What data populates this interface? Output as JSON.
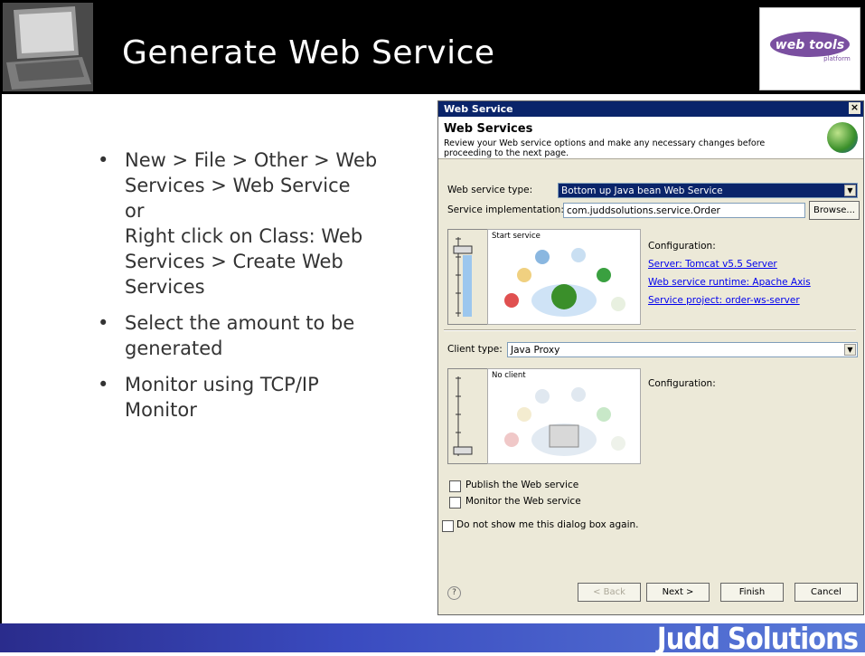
{
  "slide": {
    "title": "Generate Web Service",
    "logo_text": "web tools",
    "logo_sub": "platform",
    "footer_brand": "Judd Solutions"
  },
  "bullets": [
    {
      "lines": [
        "New > File > Other > Web",
        "Services > Web Service",
        "or",
        "Right click on Class:  Web",
        "Services > Create Web",
        "Services"
      ]
    },
    {
      "lines": [
        "Select the amount to be",
        "generated"
      ]
    },
    {
      "lines": [
        "Monitor using TCP/IP",
        "Monitor"
      ]
    }
  ],
  "dialog": {
    "title": "Web Service",
    "close_glyph": "×",
    "header_title": "Web Services",
    "header_desc": "Review your Web service options and make any necessary changes before proceeding to the next page.",
    "service_type_label": "Web service type:",
    "service_type_value": "Bottom up Java bean Web Service",
    "impl_label": "Service implementation:",
    "impl_value": "com.juddsolutions.service.Order",
    "browse_label": "Browse...",
    "server_slider_label": "Start service",
    "server_config_label": "Configuration:",
    "server_links": [
      "Server: Tomcat v5.5 Server",
      "Web service runtime: Apache Axis",
      "Service project: order-ws-server"
    ],
    "client_type_label": "Client type:",
    "client_type_value": "Java Proxy",
    "client_slider_label": "No client",
    "client_config_label": "Configuration:",
    "publish_label": "Publish the Web service",
    "monitor_label": "Monitor the Web service",
    "dont_show_label": "Do not show me this dialog box again.",
    "help_glyph": "?",
    "back_label": "< Back",
    "next_label": "Next >",
    "finish_label": "Finish",
    "cancel_label": "Cancel",
    "arrow_glyph": "▼"
  },
  "colors": {
    "header_bg": "#000000",
    "footer_start": "#2a2c8c",
    "footer_end": "#5a7bd8",
    "titlebar": "#0a246a",
    "selection": "#0a246a"
  },
  "icons": [
    "laptop-image",
    "web-tools-logo",
    "globe-icon",
    "help-icon",
    "dropdown-arrow-icon"
  ]
}
